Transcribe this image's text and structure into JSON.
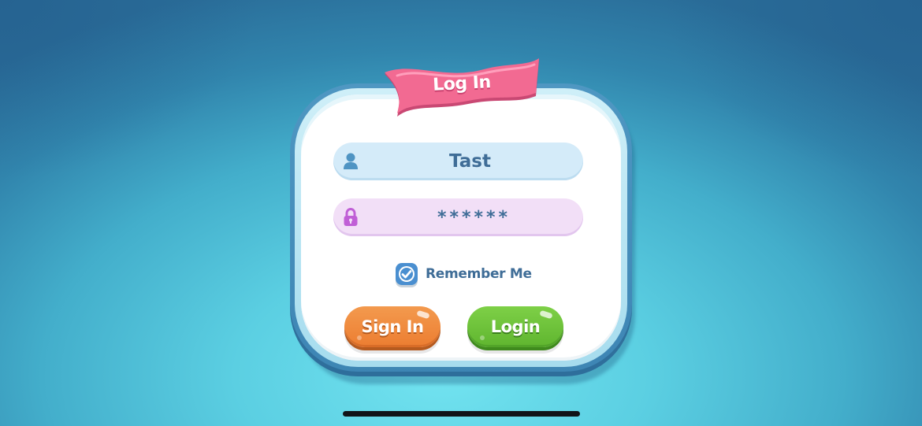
{
  "dialog": {
    "title": "Log In"
  },
  "username_field": {
    "value": "Tast",
    "icon": "user-icon"
  },
  "password_field": {
    "value": "******",
    "icon": "lock-icon"
  },
  "remember_me": {
    "label": "Remember Me",
    "checked": true
  },
  "buttons": {
    "sign_in_label": "Sign In",
    "login_label": "Login"
  },
  "colors": {
    "ribbon": "#ef5f88",
    "card_border": "#4a90bd",
    "username_field_bg": "#d4ebf9",
    "password_field_bg": "#f2dff7",
    "text": "#3f6d97",
    "sign_in_button": "#ee8535",
    "login_button": "#6cc23a",
    "checkbox": "#4a8fd0"
  }
}
